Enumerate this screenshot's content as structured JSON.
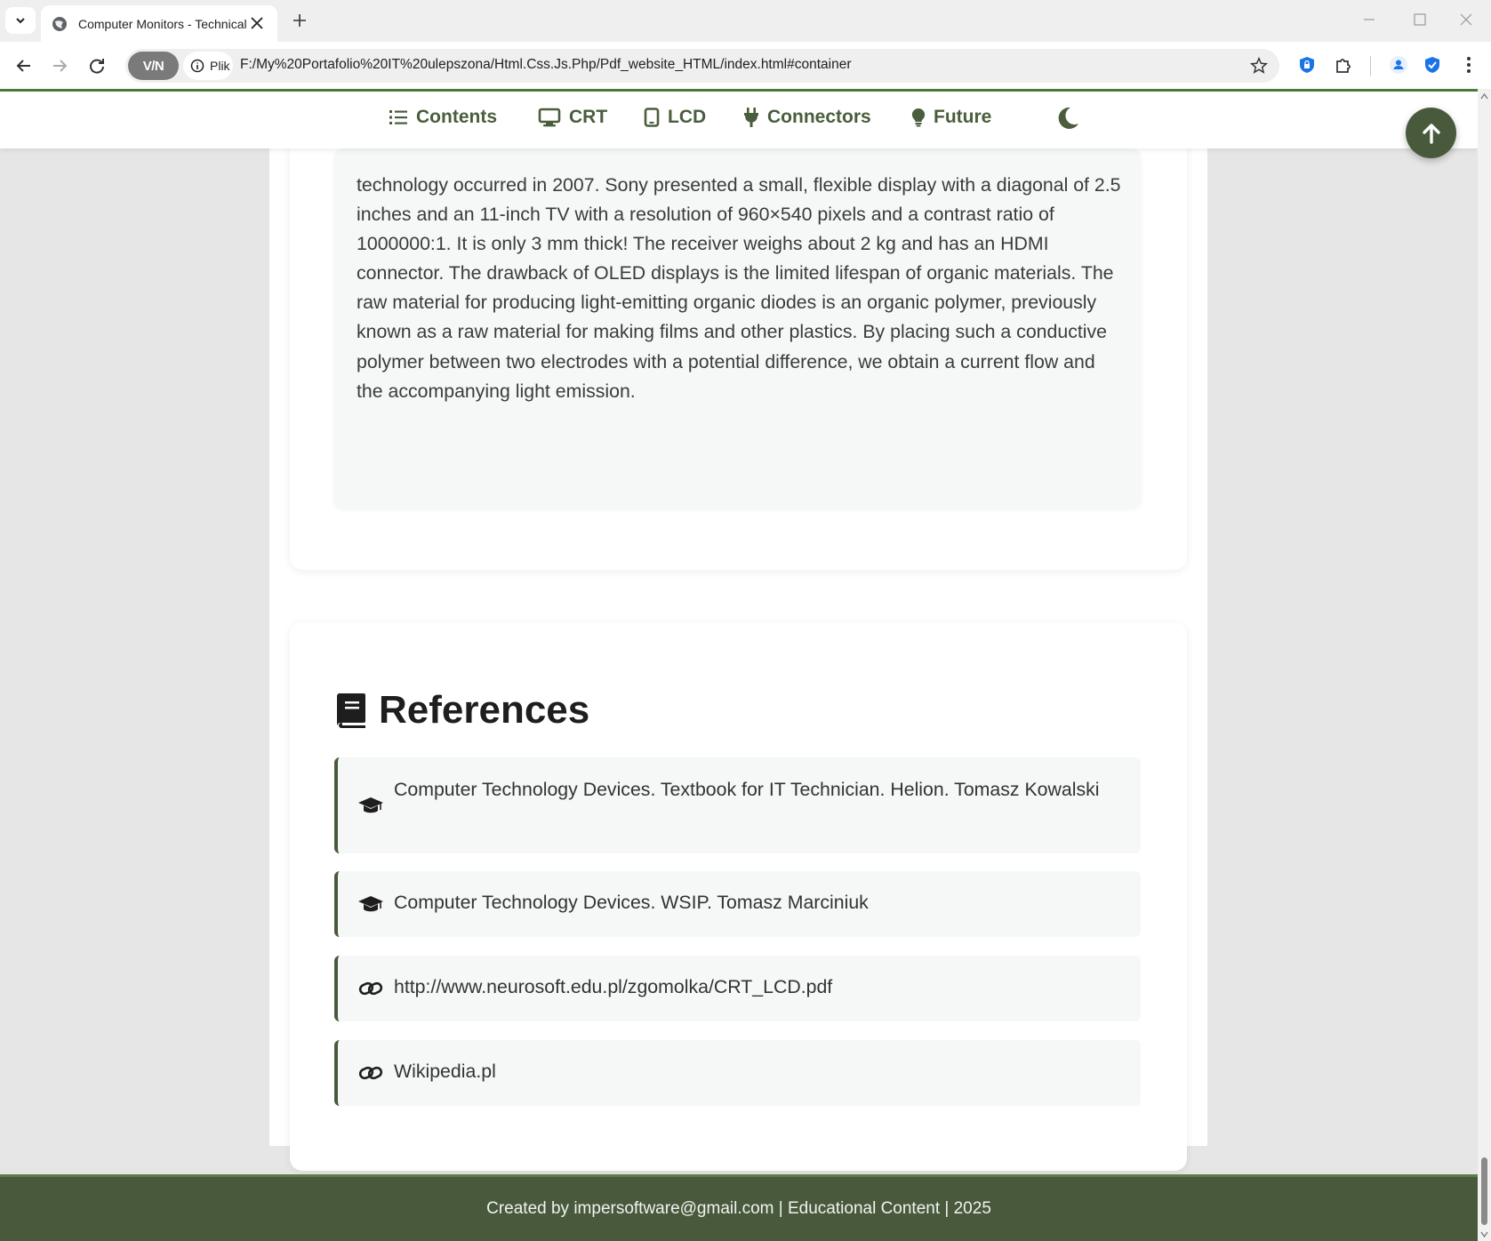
{
  "browser": {
    "tab_title": "Computer Monitors - Technical Ov",
    "url": "F:/My%20Portafolio%20IT%20ulepszona/Html.Css.Js.Php/Pdf_website_HTML/index.html#container",
    "vpn_label": "V/N",
    "site_info_label": "Plik"
  },
  "nav": {
    "items": [
      {
        "label": "Contents",
        "icon": "list-icon"
      },
      {
        "label": "CRT",
        "icon": "desktop-icon"
      },
      {
        "label": "LCD",
        "icon": "tablet-icon"
      },
      {
        "label": "Connectors",
        "icon": "plug-icon"
      },
      {
        "label": "Future",
        "icon": "lightbulb-icon"
      }
    ],
    "theme_icon": "moon-icon",
    "back_to_top_icon": "arrow-up-icon"
  },
  "article": {
    "paragraph": "technology occurred in 2007. Sony presented a small, flexible display with a diagonal of 2.5 inches and an 11-inch TV with a resolution of 960×540 pixels and a contrast ratio of 1000000:1. It is only 3 mm thick! The receiver weighs about 2 kg and has an HDMI connector. The drawback of OLED displays is the limited lifespan of organic materials. The raw material for producing light-emitting organic diodes is an organic polymer, previously known as a raw material for making films and other plastics. By placing such a conductive polymer between two electrodes with a potential difference, we obtain a current flow and the accompanying light emission."
  },
  "references": {
    "title": "References",
    "icon": "book-icon",
    "items": [
      {
        "text": "Computer Technology Devices. Textbook for IT Technician. Helion. Tomasz Kowalski",
        "icon": "graduation-cap-icon"
      },
      {
        "text": "Computer Technology Devices. WSIP. Tomasz Marciniuk",
        "icon": "graduation-cap-icon"
      },
      {
        "text": "http://www.neurosoft.edu.pl/zgomolka/CRT_LCD.pdf",
        "icon": "link-icon"
      },
      {
        "text": "Wikipedia.pl",
        "icon": "link-icon"
      }
    ]
  },
  "footer": {
    "text": "Created by impersoftware@gmail.com | Educational Content | 2025"
  },
  "colors": {
    "accent": "#485a3b",
    "nav_text": "#4a5d3c",
    "footer_bg": "#485a3b",
    "page_bg": "#e6e6e6"
  }
}
